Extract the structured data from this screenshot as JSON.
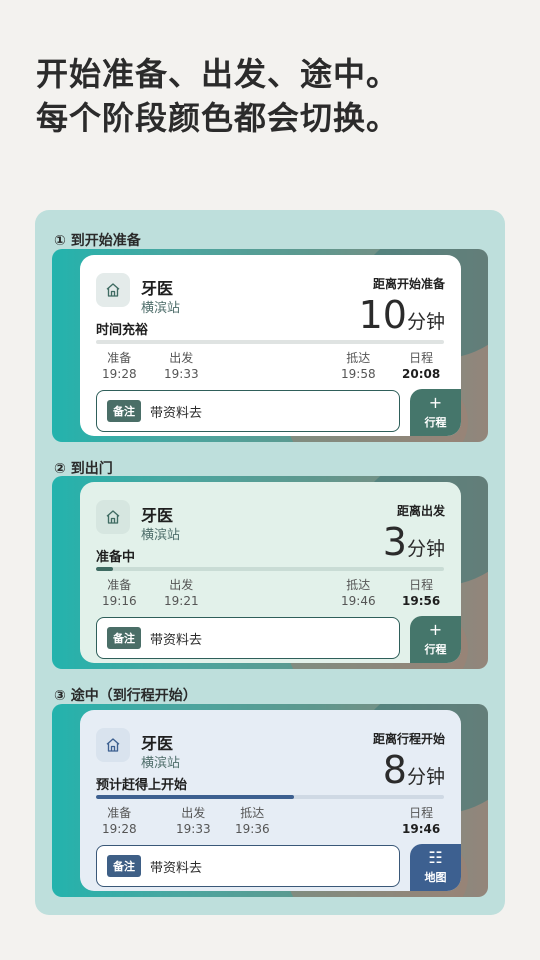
{
  "headline": {
    "line1": "开始准备、出发、途中。",
    "line2": "每个阶段颜色都会切换。"
  },
  "sections": [
    {
      "label": "① 到开始准备",
      "title": "牙医",
      "station": "横滨站",
      "countdown_label": "距离开始准备",
      "countdown_value": "10",
      "countdown_unit": "分钟",
      "status": "时间充裕",
      "progress": 0,
      "timeline": [
        {
          "label": "准备",
          "time": "19:28"
        },
        {
          "label": "出发",
          "time": "19:33"
        },
        {
          "label": "抵达",
          "time": "19:58"
        },
        {
          "label": "日程",
          "time": "20:08"
        }
      ],
      "note_badge": "备注",
      "note_text": "带资料去",
      "button_symbol": "+",
      "button_label": "行程",
      "button_icon": "plus-icon"
    },
    {
      "label": "② 到出门",
      "title": "牙医",
      "station": "横滨站",
      "countdown_label": "距离出发",
      "countdown_value": "3",
      "countdown_unit": "分钟",
      "status": "准备中",
      "progress": 0.05,
      "timeline": [
        {
          "label": "准备",
          "time": "19:16"
        },
        {
          "label": "出发",
          "time": "19:21"
        },
        {
          "label": "抵达",
          "time": "19:46"
        },
        {
          "label": "日程",
          "time": "19:56"
        }
      ],
      "note_badge": "备注",
      "note_text": "带资料去",
      "button_symbol": "+",
      "button_label": "行程",
      "button_icon": "plus-icon"
    },
    {
      "label": "③ 途中（到行程开始）",
      "title": "牙医",
      "station": "横滨站",
      "countdown_label": "距离行程开始",
      "countdown_value": "8",
      "countdown_unit": "分钟",
      "status": "预计赶得上开始",
      "progress": 0.57,
      "timeline": [
        {
          "label": "准备",
          "time": "19:28"
        },
        {
          "label": "出发",
          "time": "19:33"
        },
        {
          "label": "抵达",
          "time": "19:36"
        },
        {
          "label": "日程",
          "time": "19:46"
        }
      ],
      "note_badge": "备注",
      "note_text": "带资料去",
      "button_symbol": "☷",
      "button_label": "地图",
      "button_icon": "map-icon"
    }
  ],
  "colors": {
    "background": "#f3f2ef",
    "panel": "#bedfdc",
    "card_stage1": "#ffffff",
    "card_stage2": "#e2f1ea",
    "card_stage3": "#e6edf5",
    "progress_stage2": "#3f6b62",
    "progress_stage3": "#3d6090"
  }
}
